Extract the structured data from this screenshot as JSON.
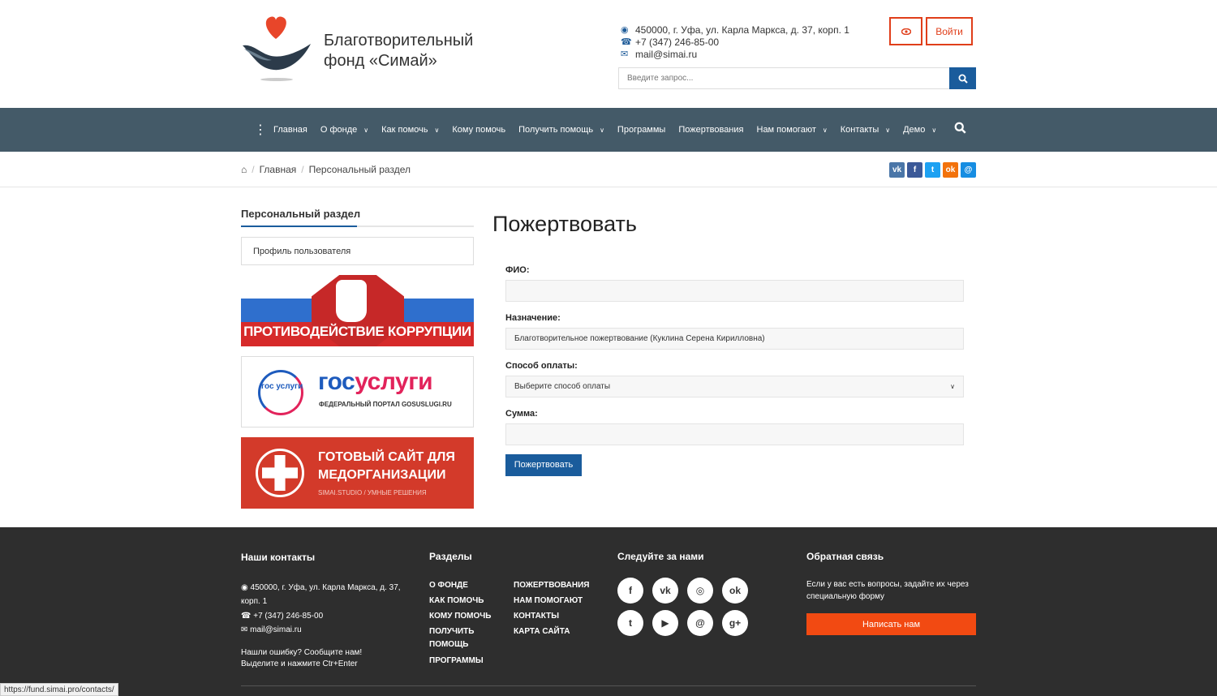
{
  "header": {
    "brand_line1": "Благотворительный",
    "brand_line2": "фонд «Симай»",
    "address": "450000, г. Уфа, ул. Карла Маркса, д. 37, корп. 1",
    "phone": "+7 (347) 246-85-00",
    "email": "mail@simai.ru",
    "login_label": "Войти",
    "search_placeholder": "Введите запрос..."
  },
  "nav": {
    "items": [
      {
        "label": "Главная",
        "dropdown": false
      },
      {
        "label": "О фонде",
        "dropdown": true
      },
      {
        "label": "Как помочь",
        "dropdown": true
      },
      {
        "label": "Кому помочь",
        "dropdown": false
      },
      {
        "label": "Получить помощь",
        "dropdown": true
      },
      {
        "label": "Программы",
        "dropdown": false
      },
      {
        "label": "Пожертвования",
        "dropdown": false
      },
      {
        "label": "Нам помогают",
        "dropdown": true
      },
      {
        "label": "Контакты",
        "dropdown": true
      },
      {
        "label": "Демо",
        "dropdown": true
      }
    ]
  },
  "breadcrumb": {
    "home": "Главная",
    "current": "Персональный раздел"
  },
  "share": [
    {
      "icon": "vk-icon",
      "glyph": "vk",
      "color": "#4a76a8"
    },
    {
      "icon": "facebook-icon",
      "glyph": "f",
      "color": "#3b5998"
    },
    {
      "icon": "twitter-icon",
      "glyph": "t",
      "color": "#1da1f2"
    },
    {
      "icon": "odnoklassniki-icon",
      "glyph": "ok",
      "color": "#f2720c"
    },
    {
      "icon": "mailru-icon",
      "glyph": "@",
      "color": "#168de2"
    }
  ],
  "sidebar": {
    "title": "Персональный раздел",
    "profile_link": "Профиль пользователя",
    "banner1_text": "ПРОТИВОДЕЙСТВИЕ КОРРУПЦИИ",
    "banner2_logo_small": "гос услуги",
    "banner2_big_a": "гос",
    "banner2_big_b": "услуги",
    "banner2_sub": "ФЕДЕРАЛЬНЫЙ ПОРТАЛ GOSUSLUGI.RU",
    "banner3_line1": "ГОТОВЫЙ САЙТ ДЛЯ",
    "banner3_line2": "МЕДОРГАНИЗАЦИИ",
    "banner3_sub": "SIMAI.STUDIO / УМНЫЕ РЕШЕНИЯ"
  },
  "main": {
    "title": "Пожертвовать",
    "fio_label": "ФИО:",
    "fio_value": "",
    "purpose_label": "Назначение:",
    "purpose_value": "Благотворительное пожертвование (Куклина Серена Кирилловна)",
    "payment_label": "Способ оплаты:",
    "payment_value": "Выберите способ оплаты",
    "sum_label": "Сумма:",
    "sum_value": "",
    "submit_label": "Пожертвовать"
  },
  "footer": {
    "contacts_title": "Наши контакты",
    "address": "450000, г. Уфа, ул. Карла Маркса, д. 37, корп. 1",
    "phone": "+7 (347) 246-85-00",
    "email": "mail@simai.ru",
    "error_note1": "Нашли ошибку? Сообщите нам!",
    "error_note2": "Выделите и нажмите Ctr+Enter",
    "sections_title": "Разделы",
    "sections_col1": [
      "О ФОНДЕ",
      "КАК ПОМОЧЬ",
      "КОМУ ПОМОЧЬ",
      "ПОЛУЧИТЬ ПОМОЩЬ",
      "ПРОГРАММЫ"
    ],
    "sections_col2": [
      "ПОЖЕРТВОВАНИЯ",
      "НАМ ПОМОГАЮТ",
      "КОНТАКТЫ",
      "КАРТА САЙТА"
    ],
    "follow_title": "Следуйте за нами",
    "social": [
      {
        "icon": "facebook-icon",
        "glyph": "f"
      },
      {
        "icon": "vk-icon",
        "glyph": "vk"
      },
      {
        "icon": "instagram-icon",
        "glyph": "◎"
      },
      {
        "icon": "odnoklassniki-icon",
        "glyph": "ok"
      },
      {
        "icon": "twitter-icon",
        "glyph": "t"
      },
      {
        "icon": "youtube-icon",
        "glyph": "▶"
      },
      {
        "icon": "mailru-icon",
        "glyph": "@"
      },
      {
        "icon": "googleplus-icon",
        "glyph": "g+"
      }
    ],
    "feedback_title": "Обратная связь",
    "feedback_text": "Если у вас есть вопросы, задайте их через специальную форму",
    "feedback_button": "Написать нам"
  },
  "status_bar": "https://fund.simai.pro/contacts/"
}
